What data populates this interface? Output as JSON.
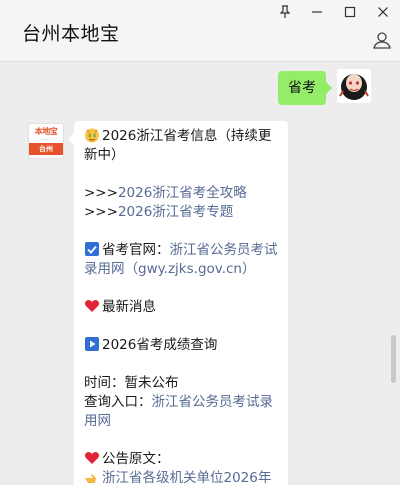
{
  "window": {
    "title": "台州本地宝",
    "controls": [
      "pin",
      "minimize",
      "maximize",
      "close"
    ]
  },
  "colors": {
    "my_bubble": "#95ec69",
    "link": "#576b95",
    "brand": "#e5532d"
  },
  "my_message": {
    "text": "省考"
  },
  "bot_avatar": {
    "top": "本地宝",
    "band": "台州"
  },
  "bot_message": {
    "heading": "2026浙江省考信息（持续更新中）",
    "links_prefix": ">>>",
    "link1": "2026浙江省考全攻略",
    "link2": "2026浙江省考专题",
    "official_label": "省考官网：",
    "official_link": "浙江省公务员考试录用网（gwy.zjks.gov.cn）",
    "latest_news": "最新消息",
    "score_query": "2026省考成绩查询",
    "time_label": "时间：暂未公布",
    "entry_label": "查询入口：",
    "entry_link": "浙江省公务员考试录用网",
    "notice_label": "公告原文：",
    "notice_link": "浙江省各级机关单位2026年"
  }
}
